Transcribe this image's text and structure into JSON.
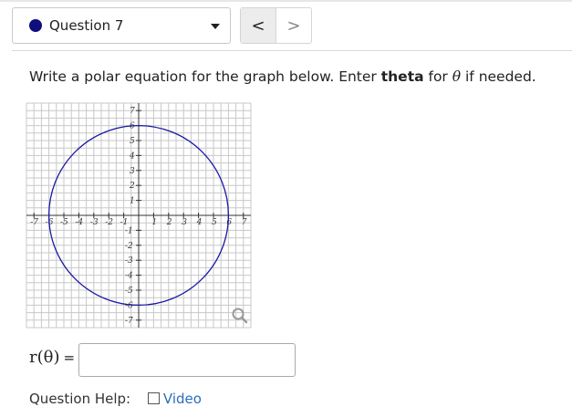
{
  "header": {
    "question_label": "Question 7",
    "prev_symbol": "<",
    "next_symbol": ">",
    "status_color": "#0e0e7e"
  },
  "prompt": {
    "before": "Write a polar equation for the graph below. Enter ",
    "keyword": "theta",
    "middle": " for ",
    "symbol": "θ",
    "after": " if needed."
  },
  "graph": {
    "x_ticks": [
      "-7",
      "-6",
      "-5",
      "-4",
      "-3",
      "-2",
      "-1",
      "1",
      "2",
      "3",
      "4",
      "5",
      "6",
      "7"
    ],
    "y_ticks_pos": [
      "7",
      "6",
      "5",
      "4",
      "3",
      "2",
      "1"
    ],
    "y_ticks_neg": [
      "-1",
      "-2",
      "-3",
      "-4",
      "-5",
      "-6",
      "-7"
    ],
    "x_range": [
      -7,
      7
    ],
    "y_range": [
      -7,
      7
    ],
    "curve": "circle centered at origin, radius 6",
    "curve_color": "#1a1aa6",
    "magnify_icon": "magnify-icon"
  },
  "answer": {
    "label": "r(θ)",
    "equals": "=",
    "value": ""
  },
  "help": {
    "label": "Question Help:",
    "video_label": "Video"
  }
}
